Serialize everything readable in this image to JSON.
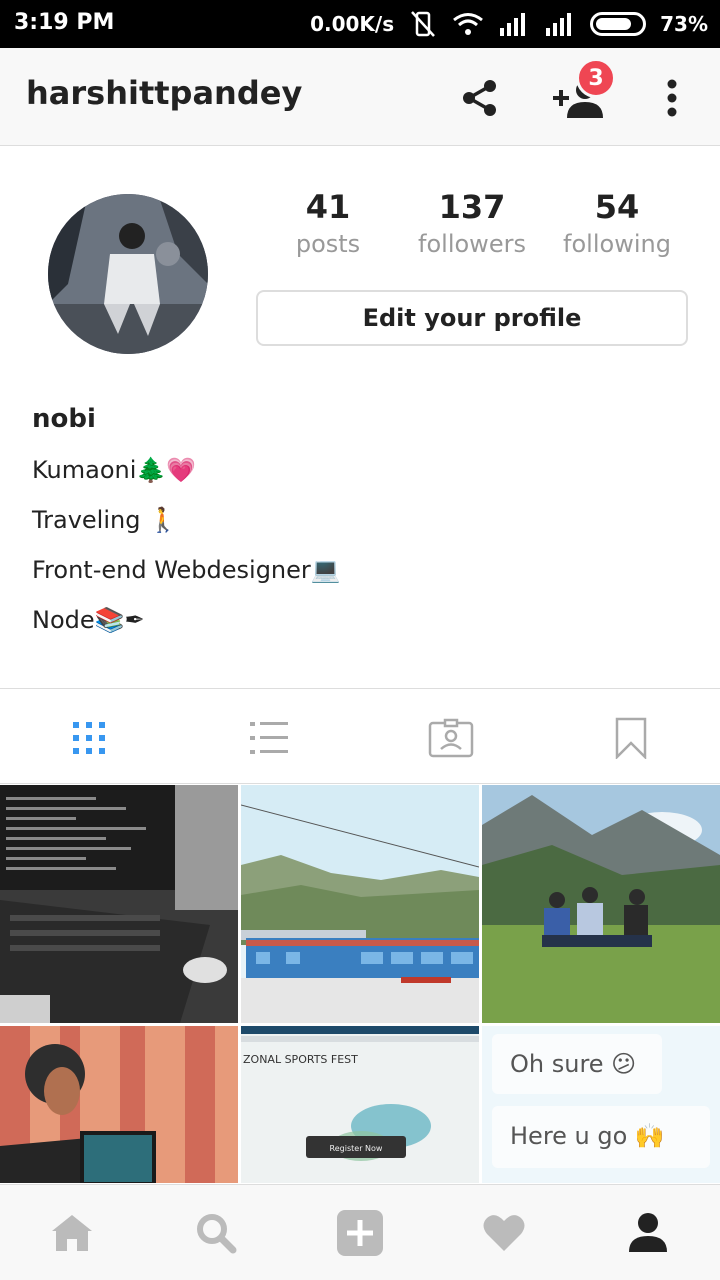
{
  "status_bar": {
    "time": "3:19 PM",
    "network_speed": "0.00K/s",
    "battery": "73%"
  },
  "header": {
    "username": "harshittpandey",
    "notification_count": "3",
    "icons": [
      "share-icon",
      "add-user-icon",
      "more-vert-icon"
    ]
  },
  "profile": {
    "stats": [
      {
        "value": "41",
        "label": "posts"
      },
      {
        "value": "137",
        "label": "followers"
      },
      {
        "value": "54",
        "label": "following"
      }
    ],
    "edit_button": "Edit your profile"
  },
  "bio": {
    "name": "nobi",
    "lines": [
      "Kumaoni🌲💗",
      "Traveling 🚶",
      "Front-end Webdesigner💻",
      "Node📚✒"
    ]
  },
  "tabs": [
    "grid-view",
    "list-view",
    "tagged",
    "saved"
  ],
  "grid": {
    "cell_texts": {
      "sports_banner": "ZONAL SPORTS FEST",
      "register": "Register Now",
      "chat_1": "Oh sure 😕",
      "chat_2": "Here u go 🙌"
    }
  },
  "bottom_nav": [
    "home",
    "search",
    "add",
    "activity",
    "profile"
  ],
  "colors": {
    "accent": "#3897f0",
    "badge": "#ef4653",
    "icon_gray": "#bbbbbb"
  }
}
